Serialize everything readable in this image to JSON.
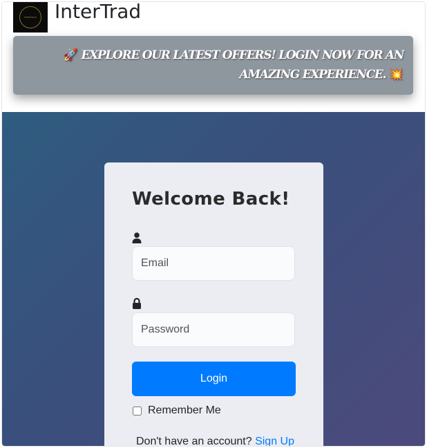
{
  "header": {
    "brand": "InterTrad",
    "logo_text": "INTERTRAD"
  },
  "promo": {
    "rocket_icon": "🚀",
    "text": " EXPLORE OUR LATEST OFFERS! LOGIN NOW FOR AN AMAZING EXPERIENCE. ",
    "spark_icon": "💥"
  },
  "login": {
    "title": "Welcome Back!",
    "email_placeholder": "Email",
    "password_placeholder": "Password",
    "login_button": "Login",
    "remember_label": "Remember Me",
    "signup_prompt": "Don't have an account? ",
    "signup_link": "Sign Up"
  },
  "colors": {
    "accent": "#007bff",
    "promo_bg": "#8f979e",
    "hero_start": "#2f5c80",
    "hero_end": "#4c4a7c",
    "card_bg": "#ebedf2"
  },
  "icons": {
    "email_field": "user-icon",
    "password_field": "lock-icon"
  }
}
